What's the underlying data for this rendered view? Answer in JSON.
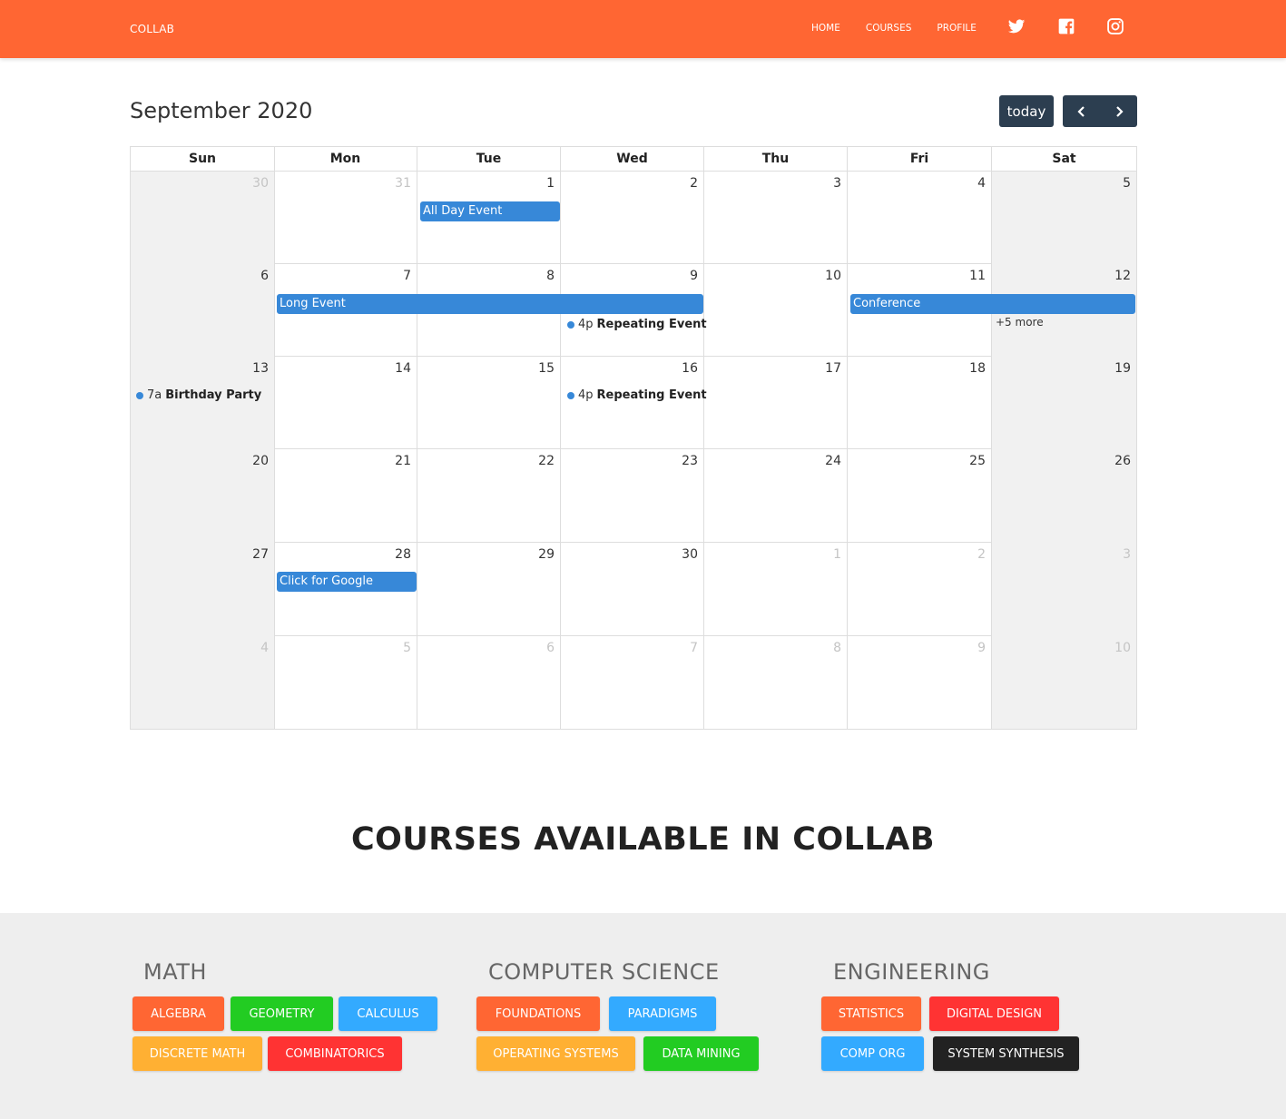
{
  "navbar": {
    "brand": "COLLAB",
    "links": [
      "HOME",
      "COURSES",
      "PROFILE"
    ],
    "social_icons": [
      "twitter-icon",
      "facebook-icon",
      "instagram-icon"
    ],
    "bg_color": "#ff6633"
  },
  "calendar": {
    "title": "September 2020",
    "today_label": "today",
    "prev_icon": "chevron-left-icon",
    "next_icon": "chevron-right-icon",
    "weekdays": [
      "Sun",
      "Mon",
      "Tue",
      "Wed",
      "Thu",
      "Fri",
      "Sat"
    ],
    "weeks": [
      [
        "30",
        "31",
        "1",
        "2",
        "3",
        "4",
        "5"
      ],
      [
        "6",
        "7",
        "8",
        "9",
        "10",
        "11",
        "12"
      ],
      [
        "13",
        "14",
        "15",
        "16",
        "17",
        "18",
        "19"
      ],
      [
        "20",
        "21",
        "22",
        "23",
        "24",
        "25",
        "26"
      ],
      [
        "27",
        "28",
        "29",
        "30",
        "1",
        "2",
        "3"
      ],
      [
        "4",
        "5",
        "6",
        "7",
        "8",
        "9",
        "10"
      ]
    ],
    "other_month": [
      [
        true,
        true,
        false,
        false,
        false,
        false,
        false
      ],
      [
        false,
        false,
        false,
        false,
        false,
        false,
        false
      ],
      [
        false,
        false,
        false,
        false,
        false,
        false,
        false
      ],
      [
        false,
        false,
        false,
        false,
        false,
        false,
        false
      ],
      [
        false,
        false,
        false,
        false,
        true,
        true,
        true
      ],
      [
        true,
        true,
        true,
        true,
        true,
        true,
        true
      ]
    ],
    "events": {
      "all_day_event": "All Day Event",
      "long_event": "Long Event",
      "conference": "Conference",
      "more": "+5 more",
      "repeating_1_time": "4p",
      "repeating_1_title": "Repeating Event",
      "birthday_time": "7a",
      "birthday_title": "Birthday Party",
      "repeating_2_time": "4p",
      "repeating_2_title": "Repeating Event",
      "google": "Click for Google"
    },
    "event_color": "#3788d8"
  },
  "courses": {
    "heading": "COURSES AVAILABLE IN COLLAB",
    "columns": [
      {
        "title": "MATH",
        "items": [
          {
            "label": "ALGEBRA",
            "color": "#ff6633"
          },
          {
            "label": "GEOMETRY",
            "color": "#22cc22"
          },
          {
            "label": "CALCULUS",
            "color": "#33aaff"
          },
          {
            "label": "DISCRETE MATH",
            "color": "#ffb033"
          },
          {
            "label": "COMBINATORICS",
            "color": "#ff3333"
          }
        ]
      },
      {
        "title": "COMPUTER SCIENCE",
        "items": [
          {
            "label": "FOUNDATIONS",
            "color": "#ff6633"
          },
          {
            "label": "PARADIGMS",
            "color": "#33aaff"
          },
          {
            "label": "OPERATING SYSTEMS",
            "color": "#ffb033"
          },
          {
            "label": "DATA MINING",
            "color": "#22cc22"
          }
        ]
      },
      {
        "title": "ENGINEERING",
        "items": [
          {
            "label": "STATISTICS",
            "color": "#ff6633"
          },
          {
            "label": "DIGITAL DESIGN",
            "color": "#ff3333"
          },
          {
            "label": "COMP ORG",
            "color": "#33aaff"
          },
          {
            "label": "SYSTEM SYNTHESIS",
            "color": "#222222"
          }
        ]
      }
    ]
  }
}
